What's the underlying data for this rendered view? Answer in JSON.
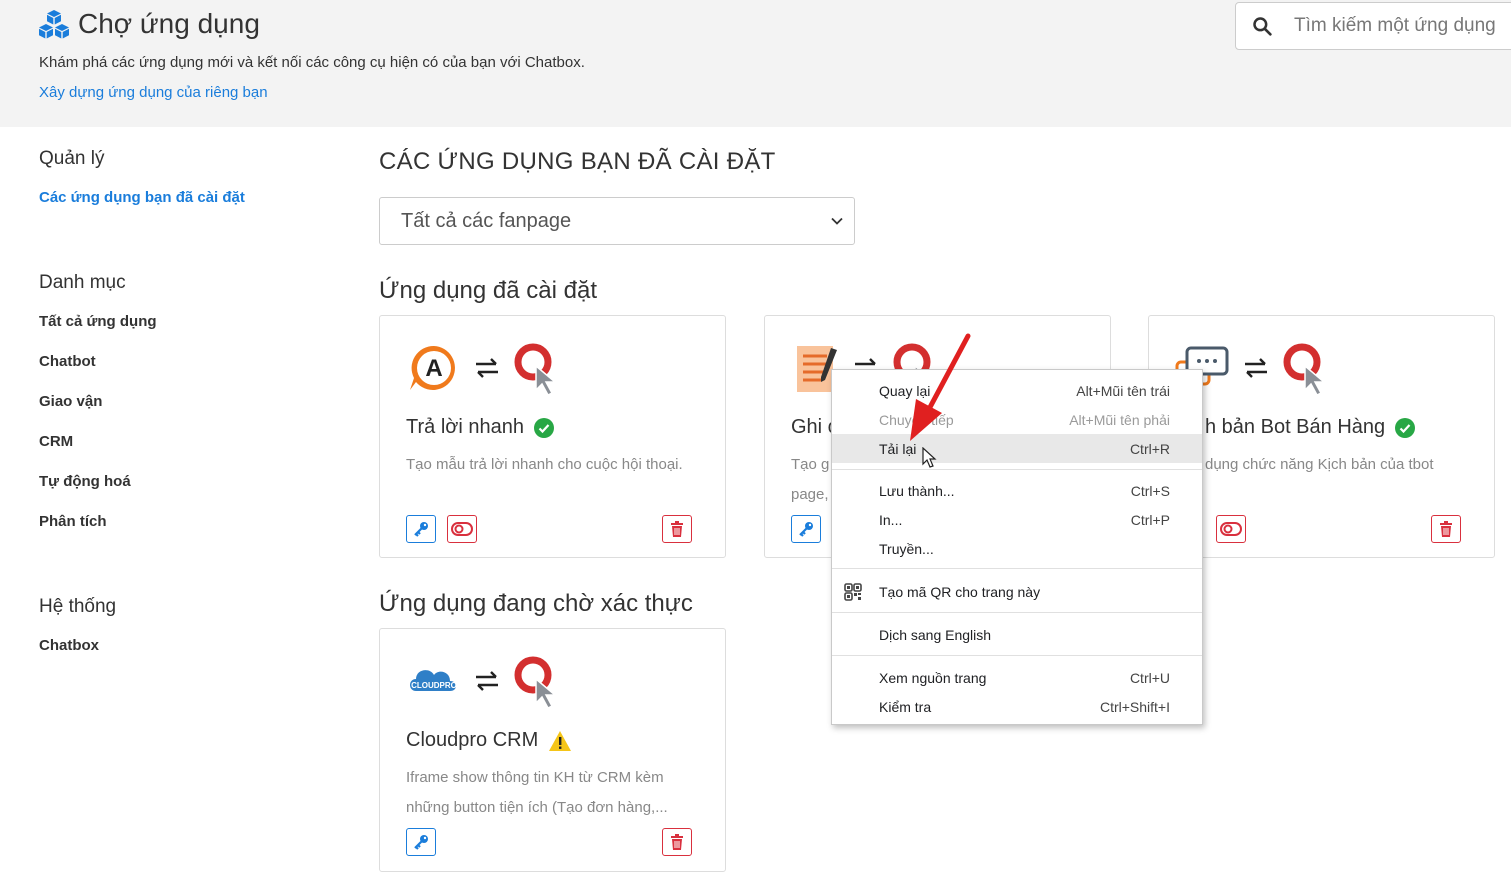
{
  "header": {
    "title": "Chợ ứng dụng",
    "subtitle": "Khám phá các ứng dụng mới và kết nối các công cụ hiện có của bạn với Chatbox.",
    "build_link": "Xây dựng ứng dụng của riêng bạn",
    "search_placeholder": "Tìm kiếm một ứng dụng"
  },
  "sidebar": {
    "manage_heading": "Quản lý",
    "manage_items": [
      {
        "label": "Các ứng dụng bạn đã cài đặt",
        "active": true
      }
    ],
    "category_heading": "Danh mục",
    "category_items": [
      {
        "label": "Tất cả ứng dụng"
      },
      {
        "label": "Chatbot"
      },
      {
        "label": "Giao vận"
      },
      {
        "label": "CRM"
      },
      {
        "label": "Tự động hoá"
      },
      {
        "label": "Phân tích"
      }
    ],
    "system_heading": "Hệ thống",
    "system_items": [
      {
        "label": "Chatbox"
      }
    ]
  },
  "main": {
    "title": "CÁC ỨNG DỤNG BẠN ĐÃ CÀI ĐẶT",
    "fanpage_select": "Tất cả các fanpage",
    "installed_heading": "Ứng dụng đã cài đặt",
    "pending_heading": "Ứng dụng đang chờ xác thực",
    "installed_apps": [
      {
        "name": "Trả lời nhanh",
        "description": "Tạo mẫu trả lời nhanh cho cuộc hội thoại.",
        "status": "verified",
        "logo": "quick-reply-icon"
      },
      {
        "name": "Ghi c",
        "description": "Tạo g page,",
        "status": "verified",
        "logo": "notes-icon"
      },
      {
        "name": "h bản Bot Bán Hàng",
        "description": "dụng chức năng Kịch bản của tbot",
        "status": "verified",
        "logo": "chat-bubbles-icon"
      }
    ],
    "pending_apps": [
      {
        "name": "Cloudpro CRM",
        "description_line1": "Iframe show thông tin KH từ CRM kèm",
        "description_line2": "những button tiện ích (Tạo đơn hàng,...",
        "status": "warning",
        "logo_text": "CLOUDPRO"
      }
    ]
  },
  "context_menu": {
    "items": [
      {
        "label": "Quay lại",
        "shortcut": "Alt+Mũi tên trái",
        "disabled": false
      },
      {
        "label": "Chuyển tiếp",
        "shortcut": "Alt+Mũi tên phải",
        "disabled": true
      },
      {
        "label": "Tải lại",
        "shortcut": "Ctrl+R",
        "hover": true
      },
      {
        "label": "Lưu thành...",
        "shortcut": "Ctrl+S"
      },
      {
        "label": "In...",
        "shortcut": "Ctrl+P"
      },
      {
        "label": "Truyền...",
        "shortcut": ""
      },
      {
        "label": "Tạo mã QR cho trang này",
        "shortcut": "",
        "icon": "qr-code-icon"
      },
      {
        "label": "Dịch sang English",
        "shortcut": ""
      },
      {
        "label": "Xem nguồn trang",
        "shortcut": "Ctrl+U"
      },
      {
        "label": "Kiểm tra",
        "shortcut": "Ctrl+Shift+I"
      }
    ]
  },
  "colors": {
    "link": "#1a7ddb",
    "danger": "#d9303e",
    "success": "#28a745",
    "warning": "#f5c518",
    "annotation_arrow": "#e02020"
  }
}
